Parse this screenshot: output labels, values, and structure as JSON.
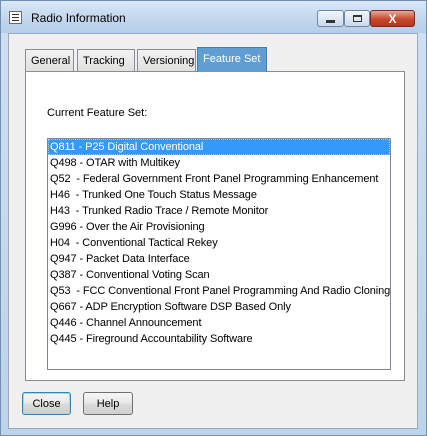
{
  "window": {
    "title": "Radio Information",
    "close_glyph": "X"
  },
  "tabs": [
    {
      "label": "General",
      "active": false
    },
    {
      "label": "Tracking",
      "active": false
    },
    {
      "label": "Versioning",
      "active": false
    },
    {
      "label": "Feature Set",
      "active": true
    }
  ],
  "feature_set": {
    "label": "Current Feature Set:",
    "selected_index": 0,
    "items": [
      "Q811 - P25 Digital Conventional",
      "Q498 - OTAR with Multikey",
      "Q52  - Federal Government Front Panel Programming Enhancement",
      "H46  - Trunked One Touch Status Message",
      "H43  - Trunked Radio Trace / Remote Monitor",
      "G996 - Over the Air Provisioning",
      "H04  - Conventional Tactical Rekey",
      "Q947 - Packet Data Interface",
      "Q387 - Conventional Voting Scan",
      "Q53  - FCC Conventional Front Panel Programming And Radio Cloning",
      "Q667 - ADP Encryption Software DSP Based Only",
      "Q446 - Channel Announcement",
      "Q445 - Fireground Accountability Software"
    ]
  },
  "buttons": {
    "close_label": "Close",
    "help_label": "Help"
  },
  "colors": {
    "selection": "#3399ff",
    "active_tab": "#5f9dd3",
    "title_bar": "#c4d8ee"
  }
}
